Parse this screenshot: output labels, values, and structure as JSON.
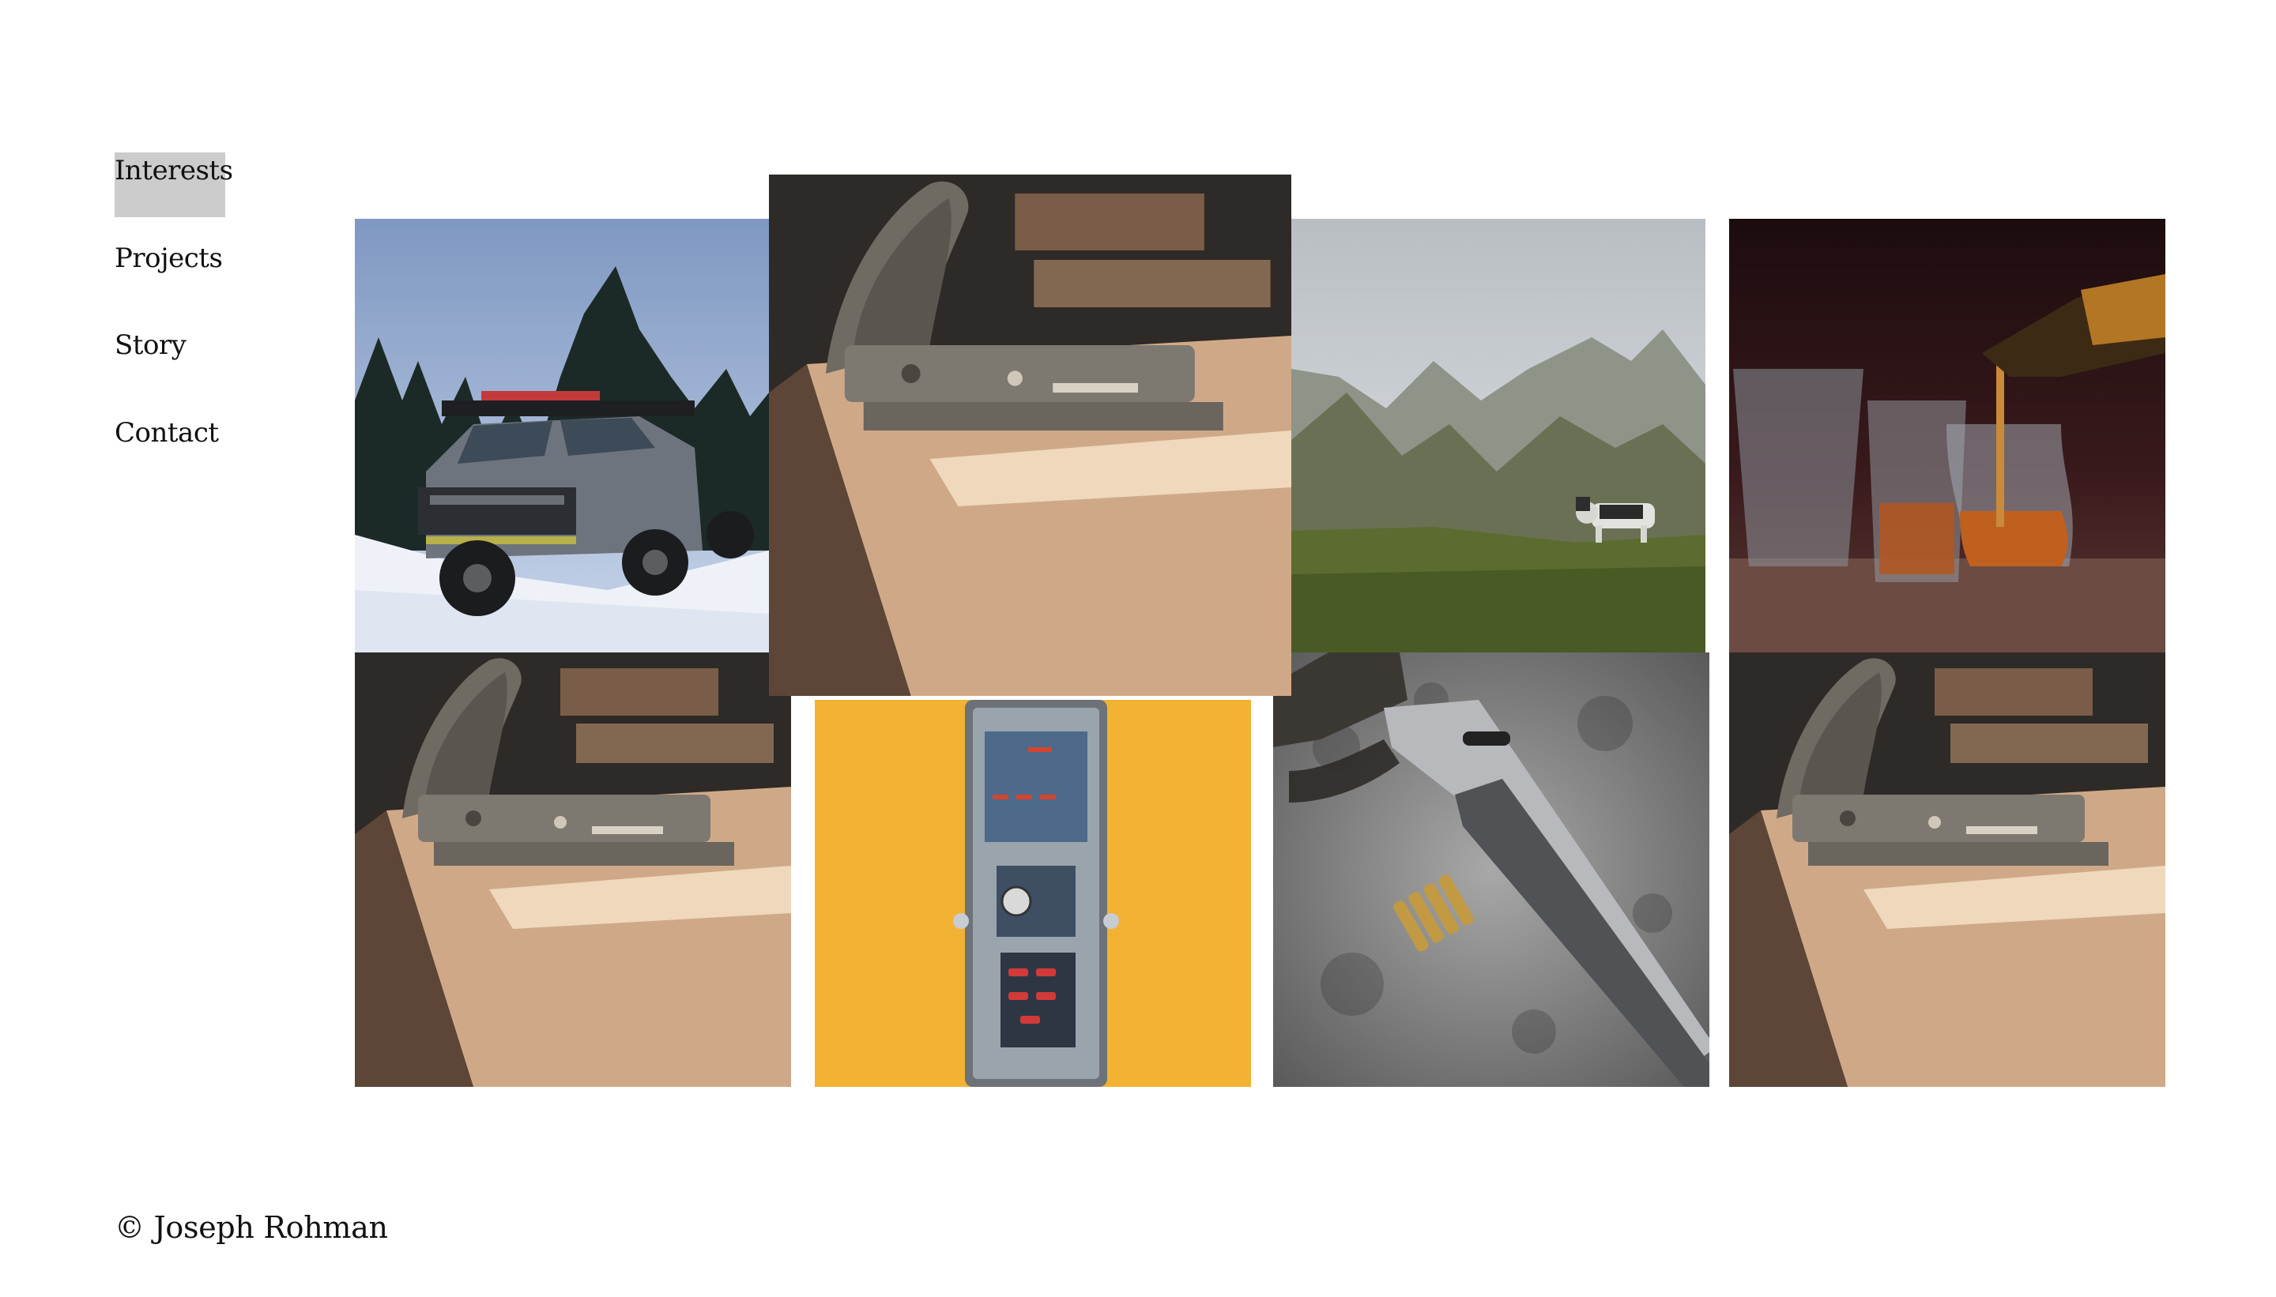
{
  "nav": {
    "items": [
      {
        "label": "Interests",
        "active": true
      },
      {
        "label": "Projects",
        "active": false
      },
      {
        "label": "Story",
        "active": false
      },
      {
        "label": "Contact",
        "active": false
      }
    ]
  },
  "footer": {
    "copyright": "© Joseph Rohman"
  },
  "gallery": {
    "tiles": [
      {
        "subject": "snow-truck-photo"
      },
      {
        "subject": "hand-plane-photo-enlarged"
      },
      {
        "subject": "mountain-dog-photo"
      },
      {
        "subject": "whisky-pour-photo"
      },
      {
        "subject": "hand-plane-photo"
      },
      {
        "subject": "guitar-pedal-circuit-photo"
      },
      {
        "subject": "lever-action-rifle-photo"
      },
      {
        "subject": "hand-plane-photo"
      }
    ]
  },
  "colors": {
    "active_nav_bg": "#cccccc",
    "text": "#111111",
    "pedal_bg": "#f2b233"
  }
}
